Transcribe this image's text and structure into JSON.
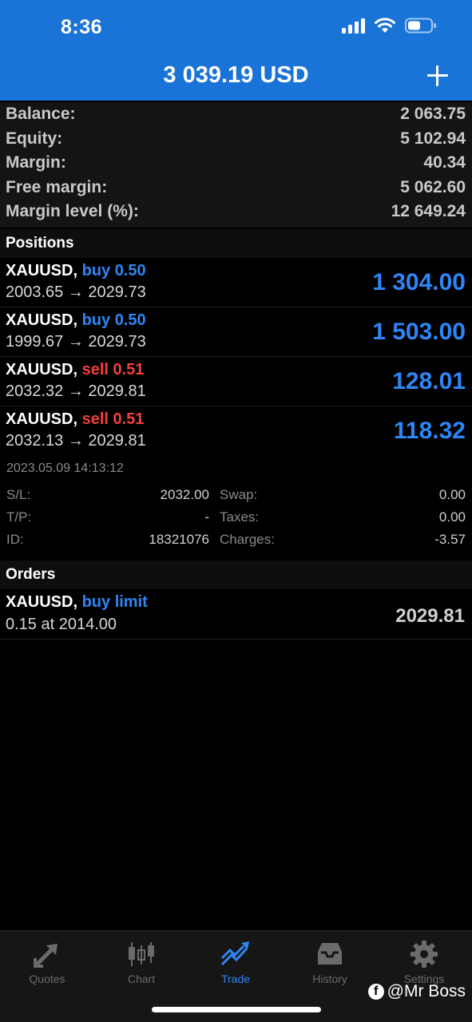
{
  "status_bar": {
    "time": "8:36"
  },
  "header": {
    "title": "3 039.19 USD"
  },
  "summary": [
    {
      "label": "Balance:",
      "value": "2 063.75"
    },
    {
      "label": "Equity:",
      "value": "5 102.94"
    },
    {
      "label": "Margin:",
      "value": "40.34"
    },
    {
      "label": "Free margin:",
      "value": "5 062.60"
    },
    {
      "label": "Margin level (%):",
      "value": "12 649.24"
    }
  ],
  "positions": {
    "title": "Positions",
    "items": [
      {
        "symbol": "XAUUSD,",
        "direction": "buy 0.50",
        "prices": "2003.65 → 2029.73",
        "profit": "1 304.00"
      },
      {
        "symbol": "XAUUSD,",
        "direction": "buy 0.50",
        "prices": "1999.67 → 2029.73",
        "profit": "1 503.00"
      },
      {
        "symbol": "XAUUSD,",
        "direction": "sell 0.51",
        "prices": "2032.32 → 2029.81",
        "profit": "128.01"
      },
      {
        "symbol": "XAUUSD,",
        "direction": "sell 0.51",
        "prices": "2032.13 → 2029.81",
        "profit": "118.32"
      }
    ]
  },
  "details": {
    "date": "2023.05.09 14:13:12",
    "rows": [
      {
        "label1": "S/L:",
        "value1": "2032.00",
        "label2": "Swap:",
        "value2": "0.00"
      },
      {
        "label1": "T/P:",
        "value1": "-",
        "label2": "Taxes:",
        "value2": "0.00"
      },
      {
        "label1": "ID:",
        "value1": "18321076",
        "label2": "Charges:",
        "value2": "-3.57"
      }
    ]
  },
  "orders": {
    "title": "Orders",
    "items": [
      {
        "symbol": "XAUUSD,",
        "direction": "buy limit",
        "desc": "0.15 at 2014.00",
        "price": "2029.81"
      }
    ]
  },
  "tabs": [
    {
      "label": "Quotes",
      "icon": "quotes-arrows-icon"
    },
    {
      "label": "Chart",
      "icon": "candlestick-icon"
    },
    {
      "label": "Trade",
      "icon": "trade-trend-icon",
      "active": true
    },
    {
      "label": "History",
      "icon": "history-inbox-icon"
    },
    {
      "label": "Settings",
      "icon": "gear-icon"
    }
  ],
  "watermark": {
    "text": "@Mr Boss",
    "icon": "facebook-icon"
  },
  "colors": {
    "header_blue": "#1a73d6",
    "buy_blue": "#2e86f5",
    "sell_red": "#f0413c"
  }
}
